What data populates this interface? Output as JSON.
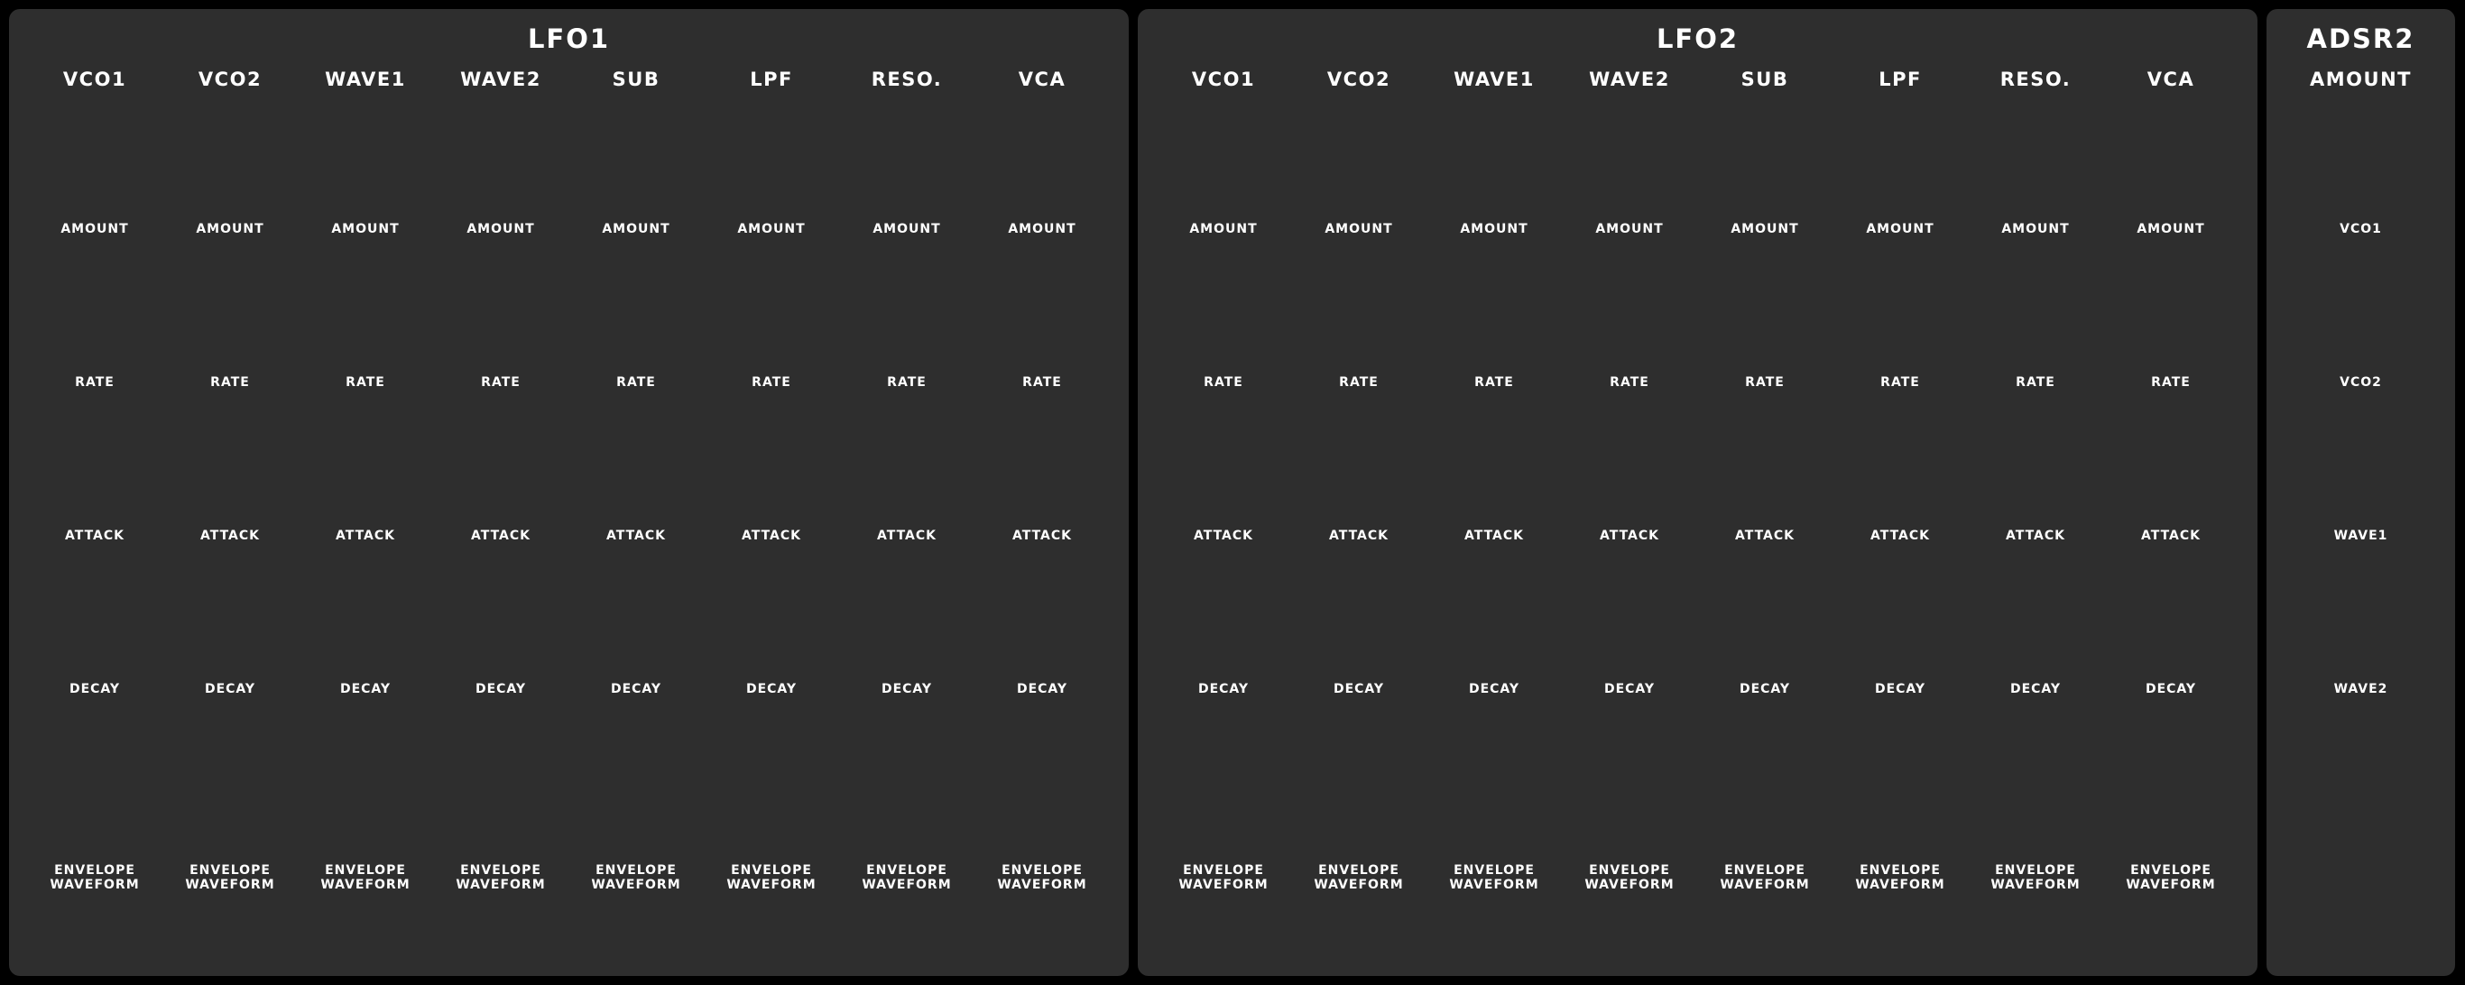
{
  "lfo1": {
    "title": "LFO1",
    "columns": [
      "VCO1",
      "VCO2",
      "WAVE1",
      "WAVE2",
      "SUB",
      "LPF",
      "RESO.",
      "VCA"
    ],
    "rows": [
      "AMOUNT",
      "RATE",
      "ATTACK",
      "DECAY"
    ],
    "envelope_line1": "ENVELOPE",
    "envelope_line2": "WAVEFORM"
  },
  "lfo2": {
    "title": "LFO2",
    "columns": [
      "VCO1",
      "VCO2",
      "WAVE1",
      "WAVE2",
      "SUB",
      "LPF",
      "RESO.",
      "VCA"
    ],
    "rows": [
      "AMOUNT",
      "RATE",
      "ATTACK",
      "DECAY"
    ],
    "envelope_line1": "ENVELOPE",
    "envelope_line2": "WAVEFORM"
  },
  "adsr2": {
    "title": "ADSR2",
    "header": "AMOUNT",
    "targets": [
      "VCO1",
      "VCO2",
      "WAVE1",
      "WAVE2"
    ]
  }
}
